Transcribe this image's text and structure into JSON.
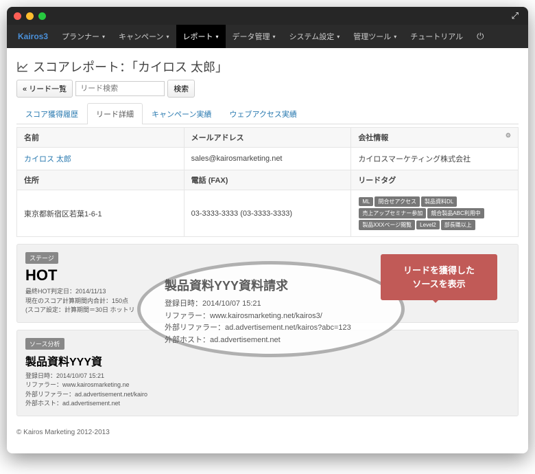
{
  "brand": "Kairos3",
  "nav": [
    "プランナー",
    "キャンペーン",
    "レポート",
    "データ管理",
    "システム設定",
    "管理ツール",
    "チュートリアル"
  ],
  "nav_active": 2,
  "page_title": "スコアレポート：「カイロス 太郎」",
  "toolbar": {
    "back": "« リード一覧",
    "placeholder": "リード検索",
    "search_btn": "検索"
  },
  "tabs": [
    "スコア獲得履歴",
    "リード詳細",
    "キャンペーン実績",
    "ウェブアクセス実績"
  ],
  "tab_active": 1,
  "headers": {
    "name": "名前",
    "email": "メールアドレス",
    "company": "会社情報",
    "address": "住所",
    "phone": "電話 (FAX)",
    "tags": "リードタグ"
  },
  "lead": {
    "name": "カイロス 太郎",
    "email": "sales@kairosmarketing.net",
    "company": "カイロスマーケティング株式会社",
    "address": "東京都新宿区若葉1-6-1",
    "phone": "03-3333-3333 (03-3333-3333)"
  },
  "lead_tags": [
    "ML",
    "問合せアクセス",
    "製品資料DL",
    "売上アップセミナー参加",
    "競合製品ABC利用中",
    "製品XXXページ閲覧",
    "Level2",
    "部長職以上"
  ],
  "stage": {
    "label": "ステージ",
    "value": "HOT",
    "line1": "最終HOT判定日：2014/11/13",
    "line2": "現在のスコア計算期間内合計：150点",
    "line3": "(スコア設定：計算期間＝30日 ホットリ"
  },
  "source": {
    "label": "ソース分析",
    "title": "製品資料YYY資",
    "line1": "登録日時：2014/10/07 15:21",
    "line2": "リファラー：www.kairosmarketing.ne",
    "line3": "外部リファラー：ad.advertisement.net/kairo",
    "line4": "外部ホスト：ad.advertisement.net"
  },
  "zoom": {
    "title": "製品資料YYY資料請求",
    "line1": "登録日時：2014/10/07 15:21",
    "line2": "リファラー：www.kairosmarketing.net/kairos3/",
    "line3": "外部リファラー：ad.advertisement.net/kairos?abc=123",
    "line4": "外部ホスト：ad.advertisement.net"
  },
  "callout": {
    "line1": "リードを獲得した",
    "line2": "ソースを表示"
  },
  "footer": "© Kairos Marketing 2012-2013"
}
